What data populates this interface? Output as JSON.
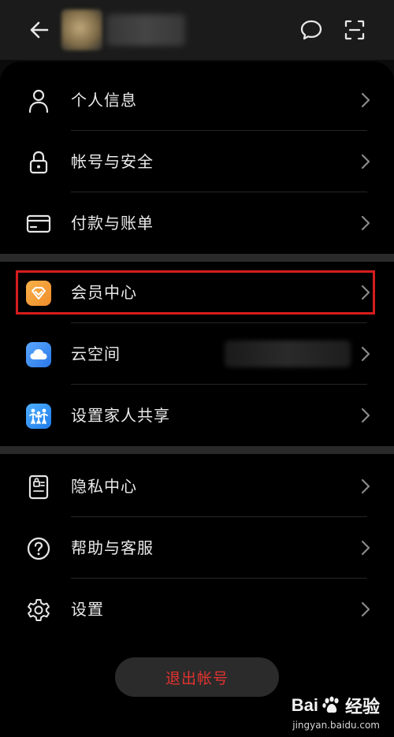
{
  "header": {
    "back_icon": "back-arrow-icon",
    "message_icon": "message-bubble-icon",
    "scan_icon": "scan-icon"
  },
  "sections": [
    {
      "items": [
        {
          "label": "个人信息",
          "icon": "person-icon"
        },
        {
          "label": "帐号与安全",
          "icon": "lock-icon"
        },
        {
          "label": "付款与账单",
          "icon": "card-icon"
        }
      ]
    },
    {
      "items": [
        {
          "label": "会员中心",
          "icon": "vip-diamond-icon",
          "highlighted": true
        },
        {
          "label": "云空间",
          "icon": "cloud-icon"
        },
        {
          "label": "设置家人共享",
          "icon": "family-icon"
        }
      ]
    },
    {
      "items": [
        {
          "label": "隐私中心",
          "icon": "privacy-icon"
        },
        {
          "label": "帮助与客服",
          "icon": "help-icon"
        },
        {
          "label": "设置",
          "icon": "gear-icon"
        }
      ]
    }
  ],
  "logout_label": "退出帐号",
  "watermark": {
    "brand": "Bai",
    "brand_tail": "经验",
    "url": "jingyan.baidu.com"
  },
  "colors": {
    "highlight": "#d51d1d",
    "logout_text": "#e2332f",
    "background": "#000000"
  }
}
